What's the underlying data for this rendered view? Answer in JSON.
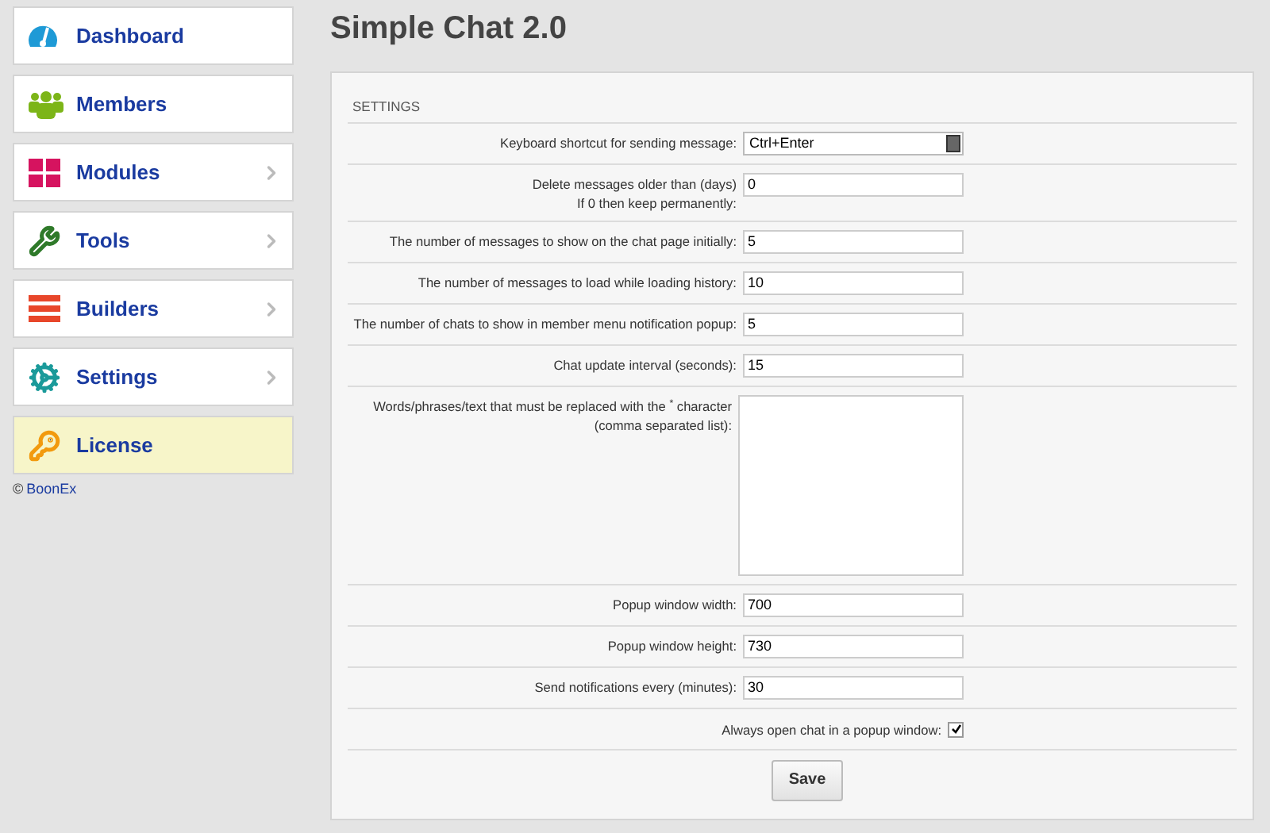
{
  "sidebar": {
    "items": [
      {
        "label": "Dashboard",
        "has_arrow": false,
        "selected": false
      },
      {
        "label": "Members",
        "has_arrow": false,
        "selected": false
      },
      {
        "label": "Modules",
        "has_arrow": true,
        "selected": false
      },
      {
        "label": "Tools",
        "has_arrow": true,
        "selected": false
      },
      {
        "label": "Builders",
        "has_arrow": true,
        "selected": false
      },
      {
        "label": "Settings",
        "has_arrow": true,
        "selected": false
      },
      {
        "label": "License",
        "has_arrow": false,
        "selected": true
      }
    ],
    "copyright": {
      "symbol": "©",
      "link": "BoonEx"
    }
  },
  "page_title": "Simple Chat 2.0",
  "settings": {
    "section_title": "SETTINGS",
    "fields": [
      {
        "kind": "select",
        "label": [
          "Keyboard shortcut for sending message:"
        ],
        "value": "Ctrl+Enter"
      },
      {
        "kind": "text",
        "label": [
          "Delete messages older than (days)",
          "If 0 then keep permanently:"
        ],
        "value": "0"
      },
      {
        "kind": "text",
        "label": [
          "The number of messages to show on the chat page initially:"
        ],
        "value": "5"
      },
      {
        "kind": "text",
        "label": [
          "The number of messages to load while loading history:"
        ],
        "value": "10"
      },
      {
        "kind": "text",
        "label": [
          "The number of chats to show in member menu notification popup:"
        ],
        "value": "5"
      },
      {
        "kind": "text",
        "label": [
          "Chat update interval (seconds):"
        ],
        "value": "15"
      },
      {
        "kind": "textarea",
        "label": [
          "Words/phrases/text that must be replaced with the $^{*}$ character",
          "(comma separated list):"
        ]
      },
      {
        "kind": "text",
        "label": [
          "Popup window width:"
        ],
        "value": "700"
      },
      {
        "kind": "text",
        "label": [
          "Popup window height:"
        ],
        "value": "730"
      },
      {
        "kind": "text",
        "label": [
          "Send notifications every (minutes):"
        ],
        "value": "30"
      },
      {
        "kind": "checkbox",
        "label": [
          "Always open chat in a popup window:"
        ],
        "checked": true
      }
    ],
    "save_button": "Save"
  }
}
